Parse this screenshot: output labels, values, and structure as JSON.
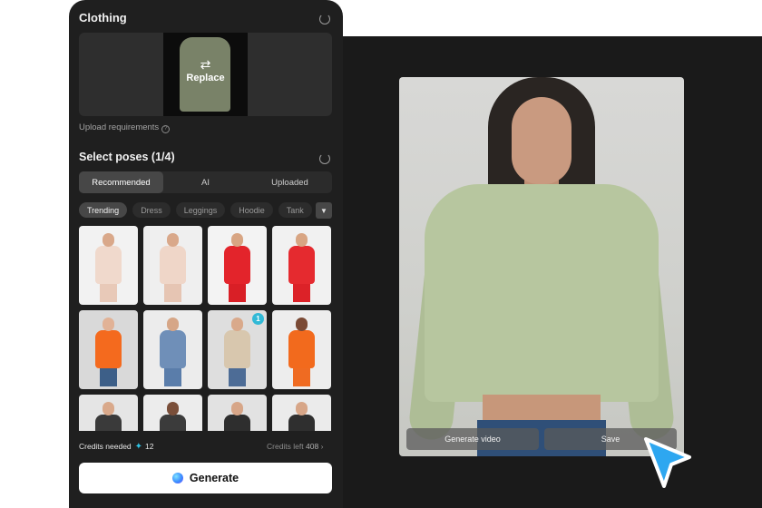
{
  "panel": {
    "clothing_title": "Clothing",
    "replace_label": "Replace",
    "upload_requirements": "Upload requirements",
    "poses_title": "Select poses (1/4)",
    "tabs": [
      {
        "label": "Recommended",
        "active": true
      },
      {
        "label": "AI",
        "active": false
      },
      {
        "label": "Uploaded",
        "active": false
      }
    ],
    "chips": [
      {
        "label": "Trending",
        "active": true
      },
      {
        "label": "Dress",
        "active": false
      },
      {
        "label": "Leggings",
        "active": false
      },
      {
        "label": "Hoodie",
        "active": false
      },
      {
        "label": "Tank",
        "active": false
      }
    ],
    "thumbnails": [
      {
        "skin": "#d9a88a",
        "top": "#f0d9cc",
        "bottom": "#e8c9b8",
        "bg": "#f2f2f2",
        "selected": false
      },
      {
        "skin": "#d9a88a",
        "top": "#efd6c8",
        "bottom": "#e6c5b3",
        "bg": "#efefef",
        "selected": false
      },
      {
        "skin": "#d8a583",
        "top": "#e3242b",
        "bottom": "#d91f26",
        "bg": "#f3f3f3",
        "selected": false
      },
      {
        "skin": "#d8a583",
        "top": "#e52a2f",
        "bottom": "#dc2228",
        "bg": "#f1f1f1",
        "selected": false
      },
      {
        "skin": "#e1b296",
        "top": "#f46a1e",
        "bottom": "#3d5f88",
        "bg": "#d9d9d9",
        "selected": false
      },
      {
        "skin": "#d6a687",
        "top": "#6f8fb8",
        "bottom": "#5a7daa",
        "bg": "#ececec",
        "selected": false
      },
      {
        "skin": "#d9a98b",
        "top": "#d8c7ae",
        "bottom": "#4d6c96",
        "bg": "#dedede",
        "selected": true,
        "badge": "1"
      },
      {
        "skin": "#7a4a35",
        "top": "#f26a1d",
        "bottom": "#ef6b22",
        "bg": "#ededed",
        "selected": false
      },
      {
        "skin": "#d9a98b",
        "top": "#3a3a3a",
        "bottom": "#333333",
        "bg": "#e5e5e5",
        "selected": false
      },
      {
        "skin": "#7a4f3a",
        "top": "#3b3b3b",
        "bottom": "#323232",
        "bg": "#ececec",
        "selected": false
      },
      {
        "skin": "#d7a688",
        "top": "#2e2e2e",
        "bottom": "#2a2a2a",
        "bg": "#e2e2e2",
        "selected": false
      },
      {
        "skin": "#d7a688",
        "top": "#2f2f2f",
        "bottom": "#2b2b2b",
        "bg": "#ebebeb",
        "selected": false
      }
    ],
    "credits_needed_label": "Credits needed",
    "credits_needed_value": "12",
    "credits_left_label": "Credits left",
    "credits_left_value": "408",
    "generate_label": "Generate"
  },
  "preview": {
    "generate_video_label": "Generate video",
    "save_label": "Save"
  },
  "colors": {
    "accent": "#2ec5e6",
    "cursor": "#2ea7f0"
  }
}
